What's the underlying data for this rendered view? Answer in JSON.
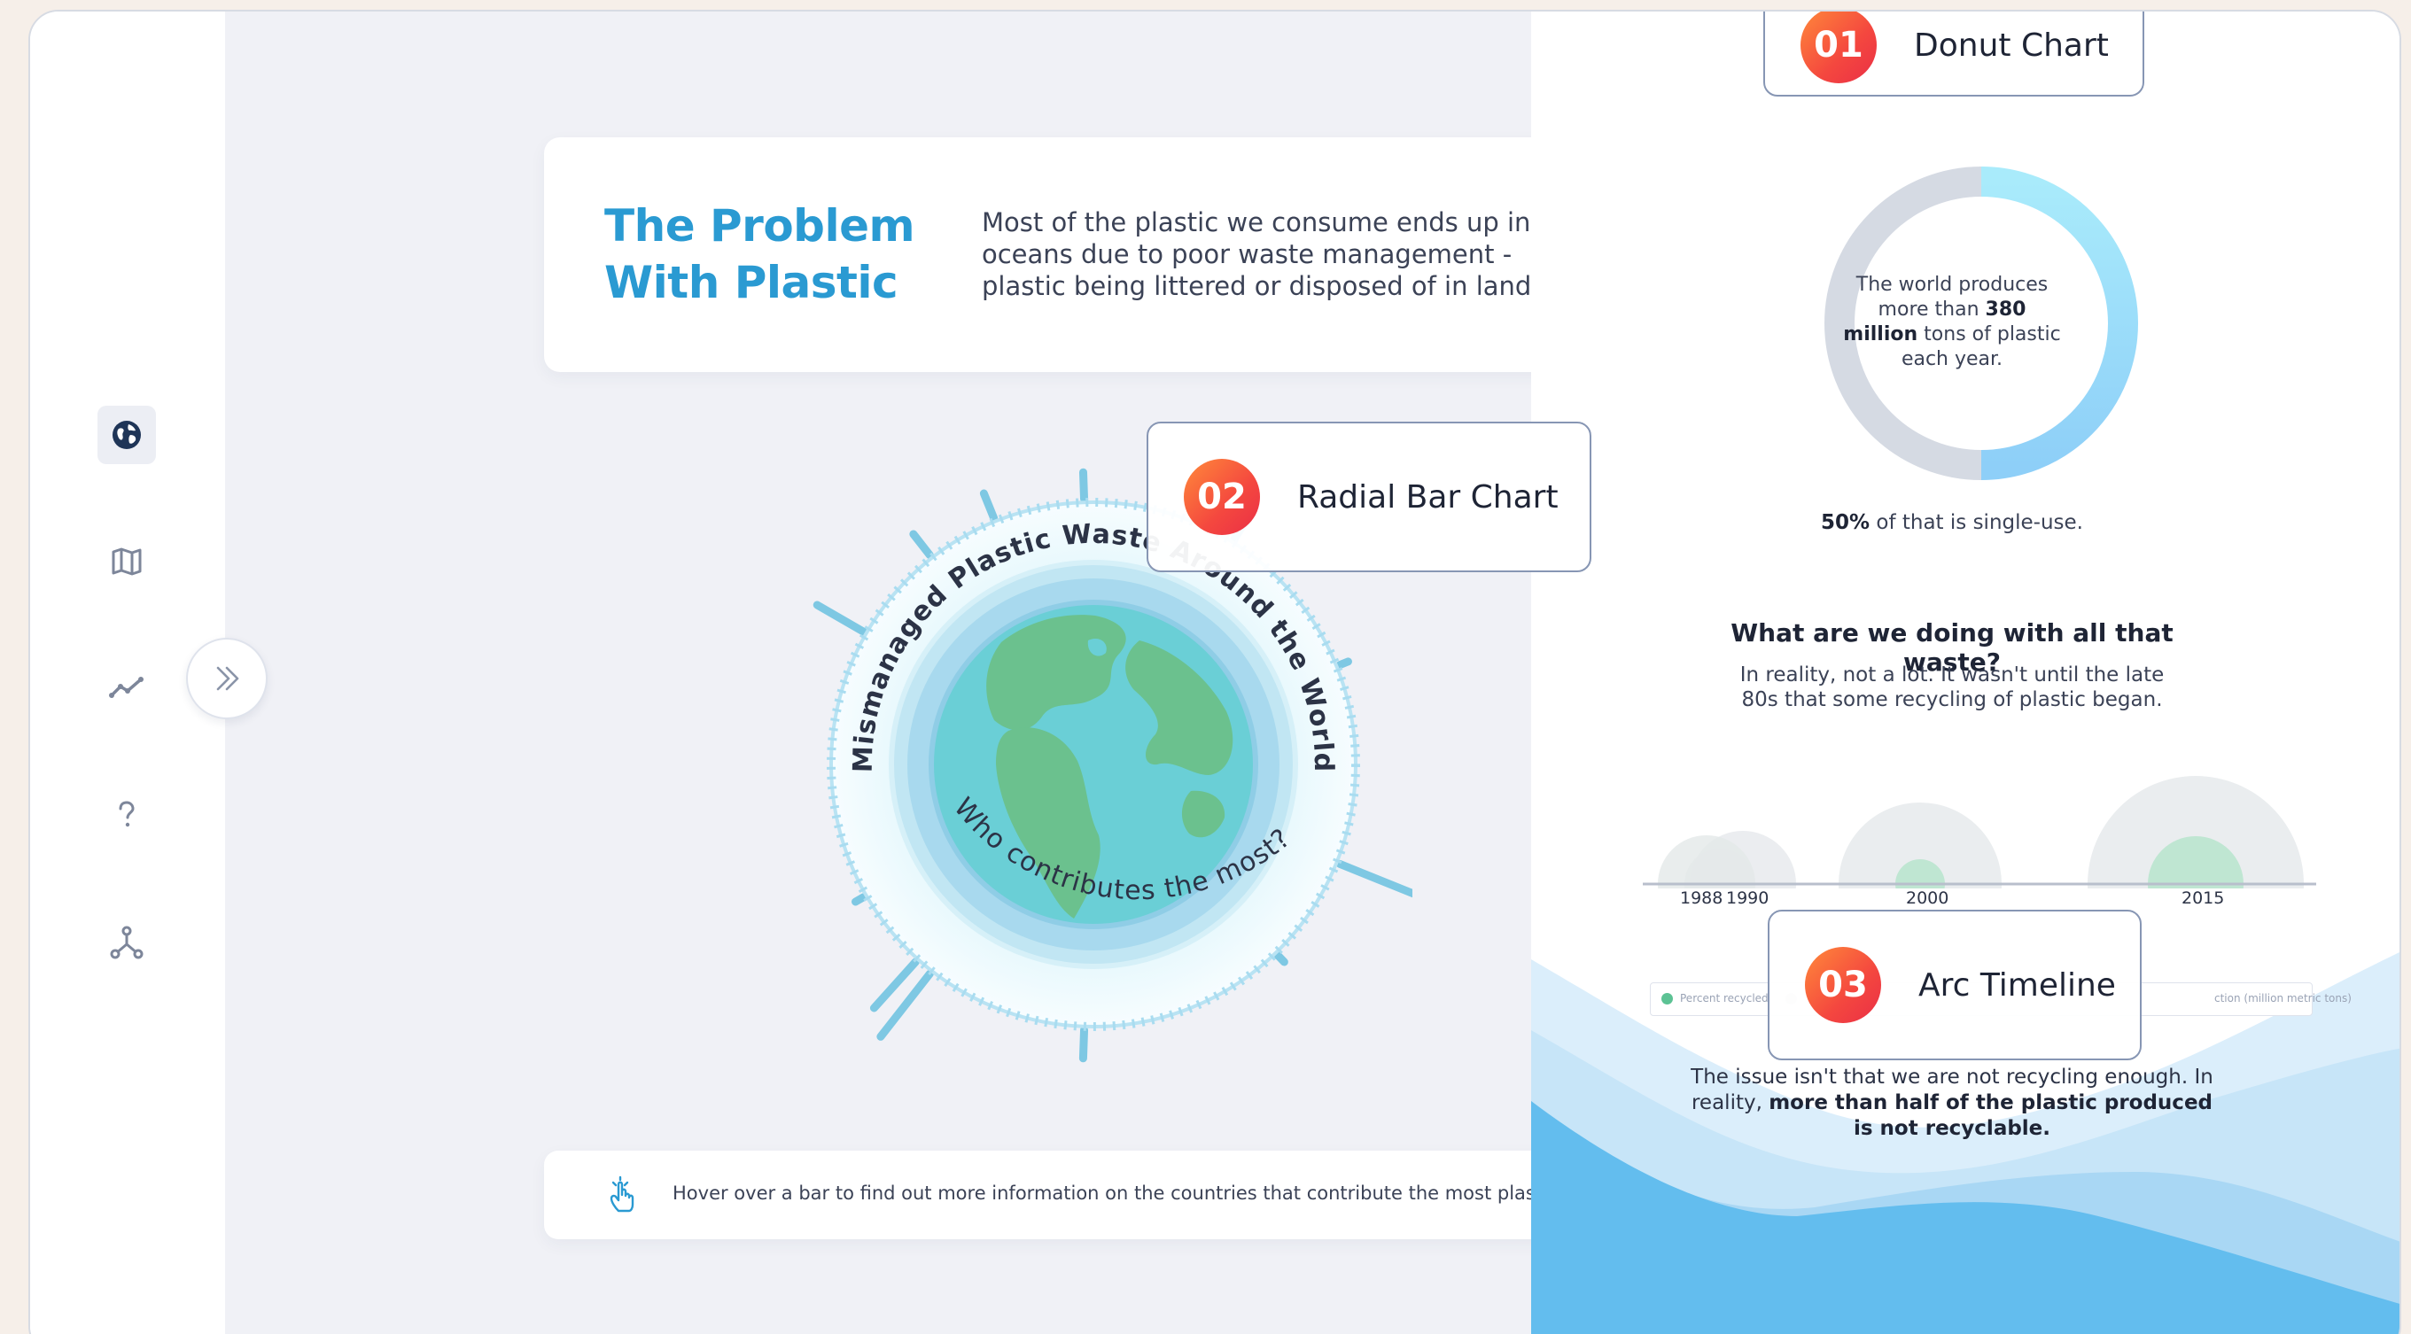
{
  "sidebar": {
    "items": [
      {
        "icon": "globe-icon",
        "active": true
      },
      {
        "icon": "map-icon",
        "active": false
      },
      {
        "icon": "line-chart-icon",
        "active": false
      },
      {
        "icon": "question-icon",
        "active": false
      },
      {
        "icon": "network-icon",
        "active": false
      }
    ],
    "expand_icon": "double-chevron-right-icon"
  },
  "intro": {
    "title_line1": "The Problem",
    "title_line2": "With Plastic",
    "text": "Most of the plastic we consume ends up in the oceans due to poor waste management - plastic being littered or disposed of in landfills."
  },
  "radial": {
    "top_text": "Mismanaged Plastic Waste Around the World",
    "bottom_text": "Who contributes the most?"
  },
  "hover_hint": {
    "icon": "pointer-hand-icon",
    "text": "Hover over a bar to find out more information on the countries that contribute the most plastic to the oceans."
  },
  "labels": [
    {
      "num": "01",
      "text": "Donut Chart"
    },
    {
      "num": "02",
      "text": "Radial Bar Chart"
    },
    {
      "num": "03",
      "text": "Arc Timeline"
    }
  ],
  "donut": {
    "text_before": "The world produces more than ",
    "text_bold": "380 million",
    "text_after": " tons of plastic each year.",
    "single_use_bold": "50%",
    "single_use_rest": " of that is single-use."
  },
  "waste": {
    "title": "What are we doing with all that waste?",
    "text": "In reality, not a lot. It wasn't until the late 80s that some recycling of plastic began."
  },
  "timeline": {
    "years": [
      "1988",
      "1990",
      "2000",
      "2015"
    ],
    "legend": {
      "recycled": "Percent recycled",
      "production_fragment": "ction (million metric tons)"
    }
  },
  "issue": {
    "text_before": "The issue isn't that we are not recycling enough. In reality, ",
    "text_bold": "more than half of the plastic produced is not recyclable."
  },
  "colors": {
    "accent_blue": "#2a9ad2",
    "badge_orange": "#f4473f",
    "recycled_green": "#5cc294",
    "wave_blue": "#63bdee"
  },
  "chart_data": {
    "type": "pie",
    "categories": [
      "single-use",
      "other"
    ],
    "values": [
      50,
      50
    ],
    "title": "",
    "annotation": "380 million tons of plastic each year"
  }
}
